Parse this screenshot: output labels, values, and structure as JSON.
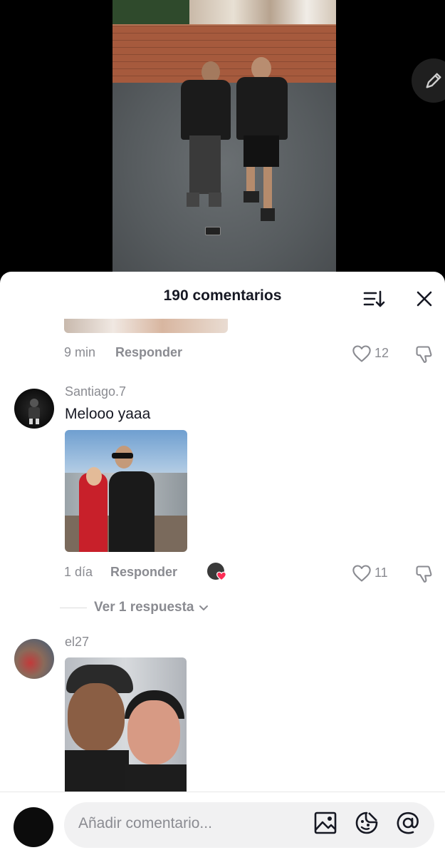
{
  "sheet": {
    "title": "190 comentarios"
  },
  "comments": [
    {
      "time": "9 min",
      "reply_label": "Responder",
      "likes": "12"
    },
    {
      "username": "Santiago.7",
      "text": "Melooo yaaa",
      "time": "1 día",
      "reply_label": "Responder",
      "likes": "11",
      "view_replies": "Ver 1 respuesta"
    },
    {
      "username": "el27"
    }
  ],
  "input": {
    "placeholder": "Añadir comentario..."
  },
  "colors": {
    "muted_text": "#8a8b91",
    "primary_text": "#161823",
    "like_badge": "#fe2c55"
  },
  "icons": [
    "pencil-icon",
    "sort-icon",
    "close-icon",
    "heart-icon",
    "dislike-icon",
    "chevron-down-icon",
    "image-icon",
    "emoji-icon",
    "mention-icon"
  ]
}
